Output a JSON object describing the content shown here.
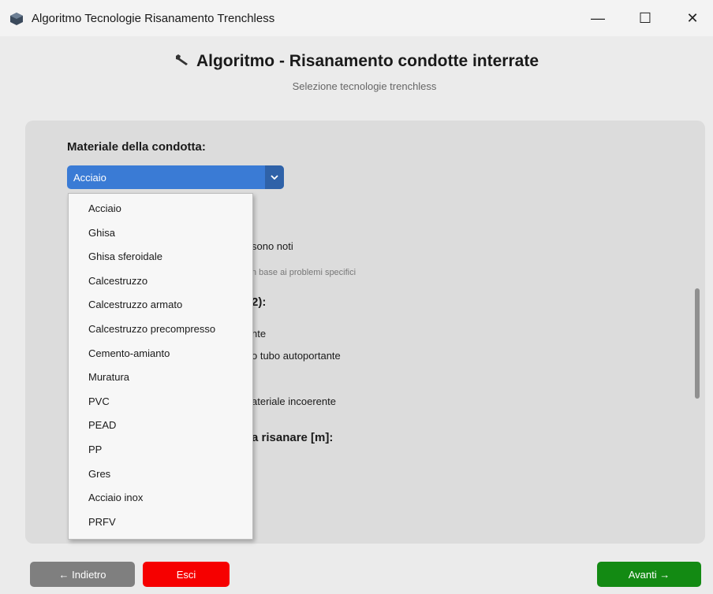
{
  "window": {
    "title": "Algoritmo Tecnologie Risanamento Trenchless",
    "minimize": "—",
    "maximize": "☐",
    "close": "✕"
  },
  "header": {
    "icon": "wrench-icon",
    "title": "Algoritmo - Risanamento condotte interrate",
    "subtitle": "Selezione tecnologie trenchless"
  },
  "form": {
    "material_label": "Materiale della condotta:",
    "material_selected": "Acciaio",
    "material_options": [
      "Acciaio",
      "Ghisa",
      "Ghisa sferoidale",
      "Calcestruzzo",
      "Calcestruzzo armato",
      "Calcestruzzo precompresso",
      "Cemento-amianto",
      "Muratura",
      "PVC",
      "PEAD",
      "PP",
      "Gres",
      "Acciaio inox",
      "PRFV"
    ]
  },
  "background_fragments": {
    "f1": "sono noti",
    "f2": "n base ai problemi specifici",
    "f3": "2):",
    "f4": "nte",
    "f5": "o tubo autoportante",
    "f6": "ateriale incoerente",
    "f7": "a risanare [m]:"
  },
  "footer": {
    "back": "← Indietro",
    "exit": "Esci",
    "next": "Avanti →"
  },
  "colors": {
    "select": "#3a7bd5",
    "back": "#7f7f7f",
    "exit": "#f60000",
    "next": "#138a13"
  }
}
